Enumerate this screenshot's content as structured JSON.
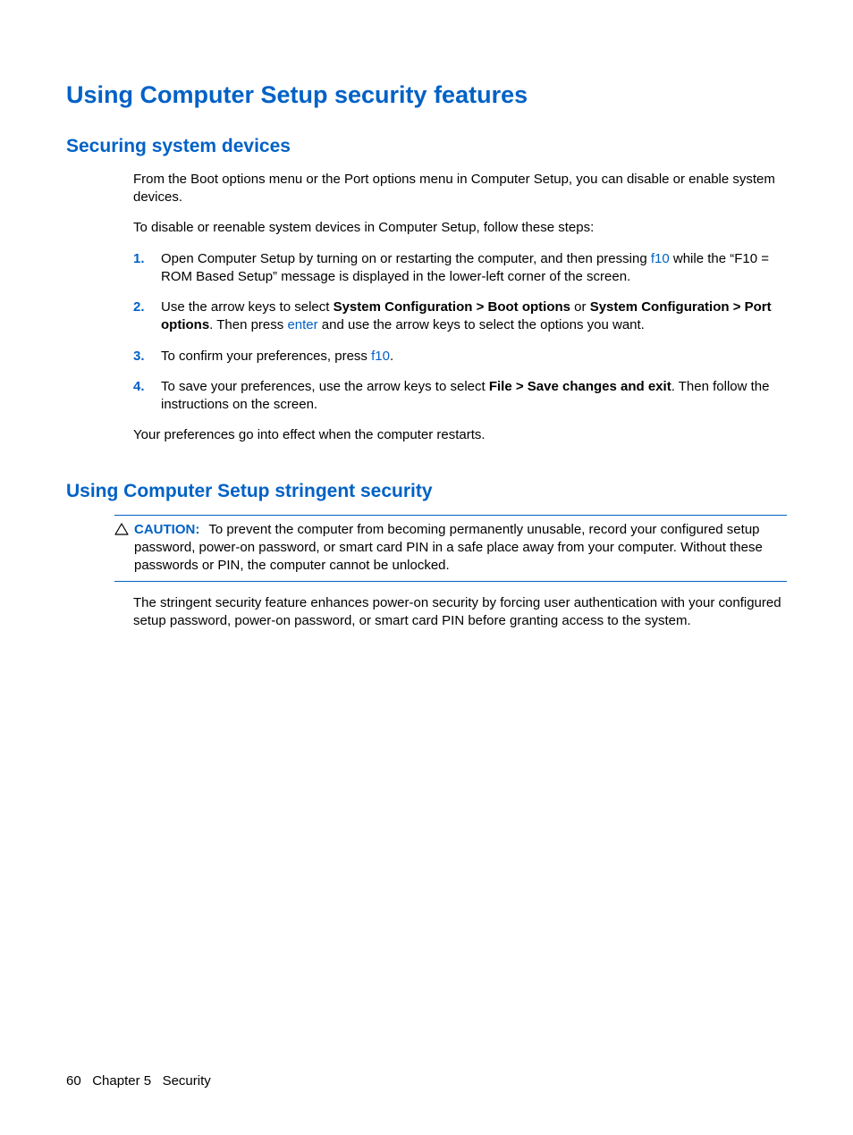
{
  "h1": "Using Computer Setup security features",
  "section1": {
    "heading": "Securing system devices",
    "p1": "From the Boot options menu or the Port options menu in Computer Setup, you can disable or enable system devices.",
    "p2": "To disable or reenable system devices in Computer Setup, follow these steps:",
    "steps": {
      "n1": "1.",
      "s1a": "Open Computer Setup by turning on or restarting the computer, and then pressing ",
      "s1key": "f10",
      "s1b": " while the “F10 = ROM Based Setup” message is displayed in the lower-left corner of the screen.",
      "n2": "2.",
      "s2a": "Use the arrow keys to select ",
      "s2b1": "System Configuration > Boot options",
      "s2c": " or ",
      "s2b2": "System Configuration > Port options",
      "s2d": ". Then press ",
      "s2key": "enter",
      "s2e": " and use the arrow keys to select the options you want.",
      "n3": "3.",
      "s3a": "To confirm your preferences, press ",
      "s3key": "f10",
      "s3b": ".",
      "n4": "4.",
      "s4a": "To save your preferences, use the arrow keys to select ",
      "s4b": "File > Save changes and exit",
      "s4c": ". Then follow the instructions on the screen."
    },
    "p3": "Your preferences go into effect when the computer restarts."
  },
  "section2": {
    "heading": "Using Computer Setup stringent security",
    "caution_label": "CAUTION:",
    "caution_text": "To prevent the computer from becoming permanently unusable, record your configured setup password, power-on password, or smart card PIN in a safe place away from your computer. Without these passwords or PIN, the computer cannot be unlocked.",
    "p1": "The stringent security feature enhances power-on security by forcing user authentication with your configured setup password, power-on password, or smart card PIN before granting access to the system."
  },
  "footer": {
    "page": "60",
    "chapter": "Chapter 5   Security"
  }
}
